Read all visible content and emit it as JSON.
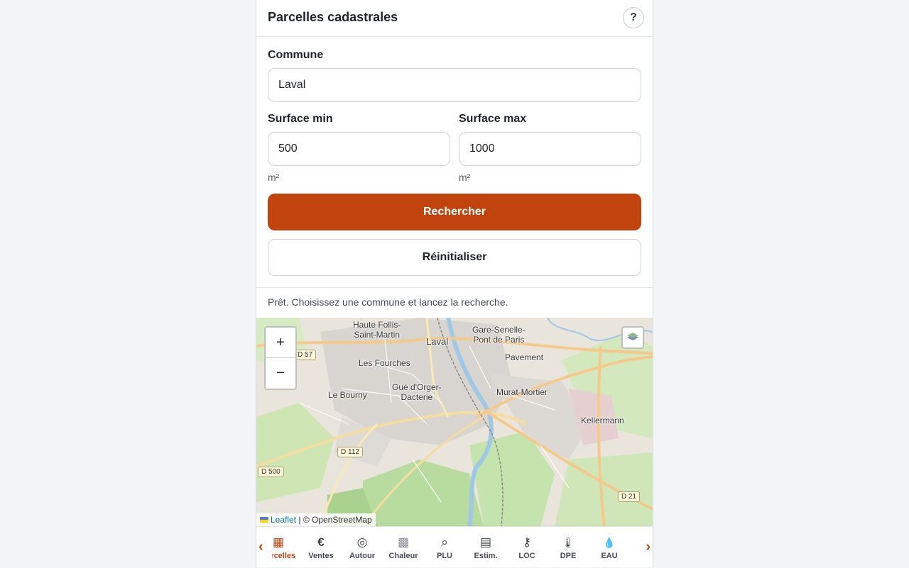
{
  "header": {
    "title": "Parcelles cadastrales",
    "help_label": "?"
  },
  "form": {
    "commune": {
      "label": "Commune",
      "value": "Laval"
    },
    "surface_min": {
      "label": "Surface min",
      "value": "500",
      "unit": "m²"
    },
    "surface_max": {
      "label": "Surface max",
      "value": "1000",
      "unit": "m²"
    },
    "search_button": "Rechercher",
    "reset_button": "Réinitialiser"
  },
  "status": "Prêt. Choisissez une commune et lancez la recherche.",
  "map": {
    "zoom_in": "+",
    "zoom_out": "−",
    "places": [
      "Haute Follis-\nSaint-Martin",
      "Laval",
      "Gare-Senelle-\nPont de Paris",
      "Pavement",
      "Les Fourches",
      "Gué d'Orger-\nDacterie",
      "Le Bourny",
      "Murat-Mortier",
      "Kellermann"
    ],
    "roads": [
      "D 57",
      "D 112",
      "D 500",
      "D 21"
    ],
    "attribution": {
      "leaflet": "Leaflet",
      "rest": " | © OpenStreetMap"
    }
  },
  "nav": {
    "prev_label": "‹",
    "next_label": "›",
    "items": [
      {
        "label": "Parcelles",
        "icon": "grid-icon",
        "glyph": "▦"
      },
      {
        "label": "Ventes",
        "icon": "euro-icon",
        "glyph": "€"
      },
      {
        "label": "Autour",
        "icon": "target-icon",
        "glyph": "◎"
      },
      {
        "label": "Chaleur",
        "icon": "heatmap-icon",
        "glyph": "▩"
      },
      {
        "label": "PLU",
        "icon": "search-icon",
        "glyph": "⌕"
      },
      {
        "label": "Estim.",
        "icon": "calculator-icon",
        "glyph": "▤"
      },
      {
        "label": "LOC",
        "icon": "key-icon",
        "glyph": "⚷"
      },
      {
        "label": "DPE",
        "icon": "thermometer-icon",
        "glyph": "🌡"
      },
      {
        "label": "EAU",
        "icon": "drop-icon",
        "glyph": "💧"
      }
    ]
  },
  "colors": {
    "accent": "#c1440e",
    "text": "#1f2328",
    "border": "#cfd3d8"
  }
}
